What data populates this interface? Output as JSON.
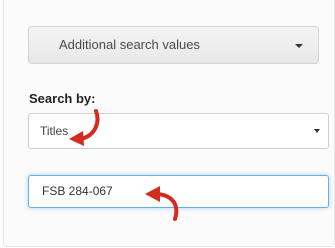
{
  "additional_search": {
    "label": "Additional search values",
    "caret_icon": "caret-down-icon"
  },
  "search_by": {
    "label": "Search by:",
    "selected_value": "Titles",
    "arrow_icon": "chevron-down-icon"
  },
  "search_input": {
    "value": "FSB 284-067"
  },
  "annotations": {
    "arrow_color": "#d52b1e"
  },
  "colors": {
    "focus_border": "#66afe9"
  }
}
